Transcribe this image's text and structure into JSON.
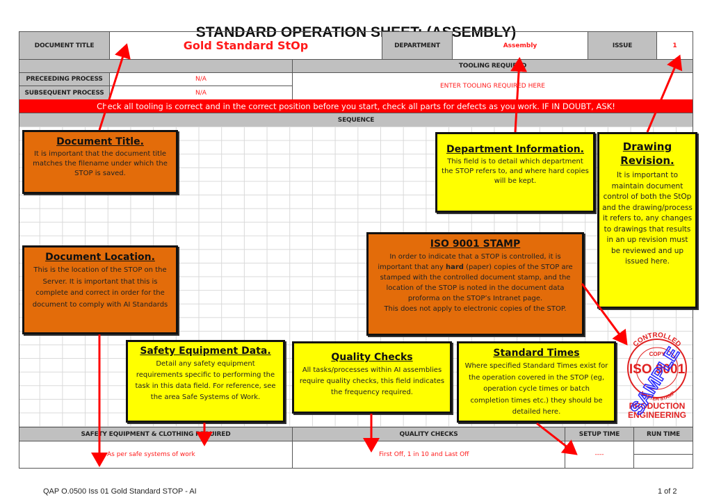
{
  "page_title": "STANDARD OPERATION SHEET: (ASSEMBLY)",
  "header": {
    "document_title_label": "DOCUMENT TITLE",
    "document_title_value": "Gold Standard StOp",
    "department_label": "DEPARTMENT",
    "department_value": "Assembly",
    "issue_label": "ISSUE",
    "issue_value": "1"
  },
  "process": {
    "tooling_header": "TOOLING REQUIRED",
    "tooling_value": "ENTER TOOLING REQUIRED HERE",
    "preceeding_label": "PRECEEDING PROCESS",
    "preceeding_value": "N/A",
    "subsequent_label": "SUBSEQUENT PROCESS",
    "subsequent_value": "N/A"
  },
  "warning_banner": "Check all tooling is correct and in the correct position before you start, check all parts for defects as you work. IF IN DOUBT, ASK!",
  "sequence_header": "SEQUENCE",
  "callouts": {
    "document_title": {
      "heading": "Document Title.",
      "body": "It is important that the document title matches the filename under which the STOP is saved."
    },
    "department_info": {
      "heading": "Department Information.",
      "body": "This field is to detail which department the STOP refers to, and where hard copies will be kept."
    },
    "drawing_revision": {
      "heading": "Drawing Revision.",
      "body": "It is important to maintain document control of both the StOp and the drawing/process it refers to, any changes to drawings that results in an up revision must be reviewed and up issued here."
    },
    "document_location": {
      "heading": "Document Location.",
      "body": "This is the location of the STOP on the Server.  It is important that this is complete and correct in order for the document to comply with AI Standards"
    },
    "iso_stamp": {
      "heading": "ISO 9001 STAMP",
      "body_pre": "In order to indicate that a STOP is controlled, it is important that any ",
      "body_bold": "hard",
      "body_post": " (paper) copies of the STOP are stamped with the controlled document stamp, and the location of the STOP is noted in the document data proforma on the STOP’s Intranet page.",
      "body_last": "This does not apply to electronic copies of the STOP."
    },
    "safety_equipment": {
      "heading": "Safety Equipment Data.",
      "body": "Detail any safety equipment requirements specific to performing the task in this data field. For reference, see the area Safe Systems of Work."
    },
    "quality_checks": {
      "heading": "Quality Checks",
      "body": "All tasks/processes within AI assemblies require quality checks, this field indicates the frequency required."
    },
    "standard_times": {
      "heading": "Standard Times",
      "body": "Where specified Standard Times exist for the operation covered in the STOP (eg, operation cycle times or batch completion times etc.) they should be detailed here."
    }
  },
  "stamp": {
    "line1": "CONTROLLED",
    "line2": "COPY",
    "line3": "ISO 9001",
    "line4": "MASTER STAMP",
    "line5": "PRODUCTION",
    "line6": "ENGINEERING",
    "overlay": "SAMPLE"
  },
  "bottom": {
    "safety_header": "SAFETY EQUIPMENT & CLOTHING REQUIRED",
    "safety_value": "As per safe systems of work",
    "quality_header": "QUALITY CHECKS",
    "quality_value": "First Off, 1 in 10 and Last Off",
    "setup_header": "SETUP TIME",
    "setup_value": "----",
    "run_header": "RUN TIME",
    "run_value": ""
  },
  "footer": {
    "doc_ref": "QAP O.0500 Iss 01 Gold Standard STOP - AI",
    "page": "1 of 2"
  },
  "colors": {
    "header_grey": "#c0c0c0",
    "value_red": "#ff1a1a",
    "banner_red": "#ff0000",
    "callout_orange": "#e36c0a",
    "callout_yellow": "#ffff00",
    "stamp_red": "#e02020",
    "stamp_blue": "#2a2aff"
  }
}
